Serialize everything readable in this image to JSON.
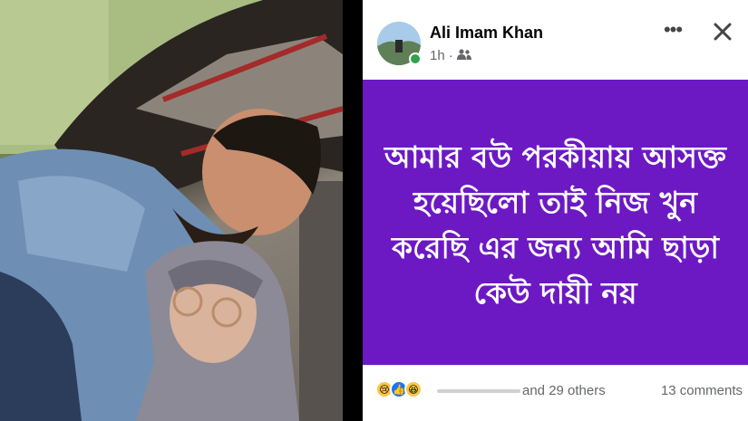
{
  "photo": {
    "description_icon": "couple-selfie-photo"
  },
  "post": {
    "author": "Ali Imam Khan",
    "time": "1h",
    "audience_icon": "friends-icon",
    "body_text": "আমার বউ পরকীয়ায় আসক্ত হয়েছিলো তাই নিজ খুন করেছি এর জন্য আমি ছাড়া কেউ দায়ী নয়",
    "background_color": "#6c19c4",
    "reactions": [
      "sad",
      "like",
      "haha"
    ],
    "others_text": "and 29 others",
    "comments_text": "13 comments"
  }
}
